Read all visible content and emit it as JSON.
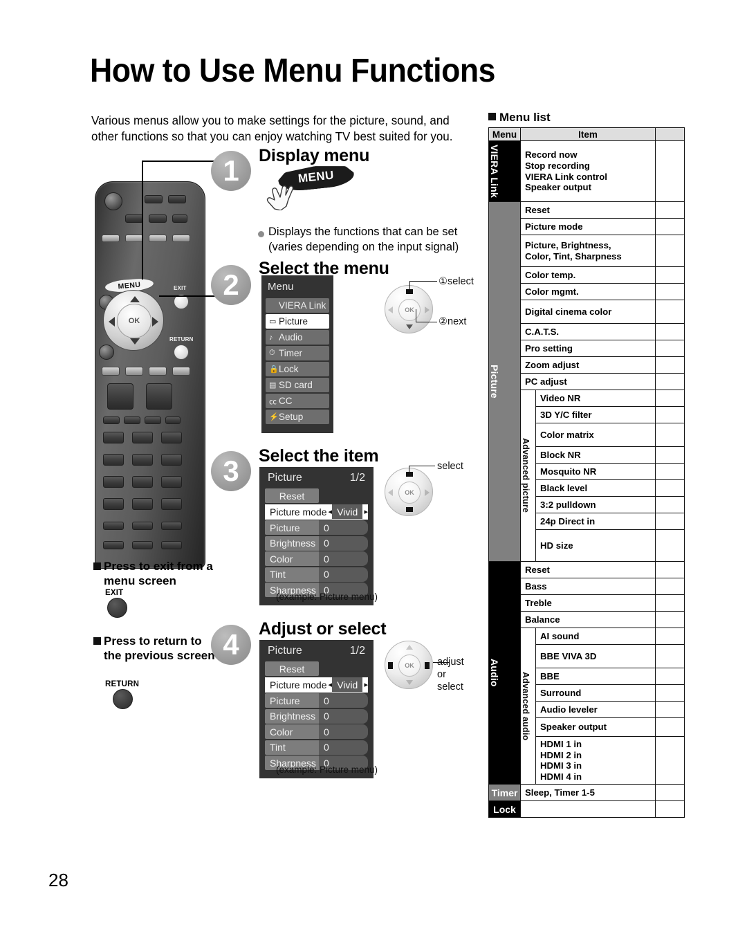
{
  "page": {
    "title": "How to Use Menu Functions",
    "number": "28",
    "intro": "Various menus allow you to make settings for the picture, sound, and other functions so that you can enjoy watching TV best suited for you."
  },
  "steps": [
    {
      "num": "1",
      "title": "Display menu"
    },
    {
      "num": "2",
      "title": "Select the menu"
    },
    {
      "num": "3",
      "title": "Select the item"
    },
    {
      "num": "4",
      "title": "Adjust or select"
    }
  ],
  "step1": {
    "button_label": "MENU",
    "bullet": "Displays the functions that can be set (varies depending on the input signal)"
  },
  "remote": {
    "menu_label": "MENU",
    "exit_label": "EXIT",
    "return_label": "RETURN",
    "ok_label": "OK"
  },
  "step2": {
    "osd_title": "Menu",
    "items": [
      {
        "glyph": "",
        "label": "VIERA Link",
        "active": false
      },
      {
        "glyph": "▭",
        "label": "Picture",
        "active": true
      },
      {
        "glyph": "♪",
        "label": "Audio",
        "active": false
      },
      {
        "glyph": "⏱",
        "label": "Timer",
        "active": false
      },
      {
        "glyph": "🔒",
        "label": "Lock",
        "active": false
      },
      {
        "glyph": "▤",
        "label": "SD card",
        "active": false
      },
      {
        "glyph": "㏄",
        "label": "CC",
        "active": false
      },
      {
        "glyph": "⚡",
        "label": "Setup",
        "active": false
      }
    ],
    "pad_label_1": "①select",
    "pad_label_2": "②next",
    "ok_label": "OK"
  },
  "picture_osd": {
    "title": "Picture",
    "page": "1/2",
    "reset_label": "Reset",
    "selected": {
      "name": "Picture mode",
      "value": "Vivid",
      "left_caret": "◂",
      "right_caret": "▸"
    },
    "rows": [
      {
        "name": "Picture",
        "value": "0"
      },
      {
        "name": "Brightness",
        "value": "0"
      },
      {
        "name": "Color",
        "value": "0"
      },
      {
        "name": "Tint",
        "value": "0"
      },
      {
        "name": "Sharpness",
        "value": "0"
      }
    ],
    "caption": "(example:  Picture menu)"
  },
  "step3": {
    "pad_label": "select",
    "ok_label": "OK"
  },
  "step4": {
    "pad_label": "adjust\nor\nselect",
    "ok_label": "OK"
  },
  "notes": [
    {
      "heading": "Press to exit from a menu screen",
      "button": "EXIT"
    },
    {
      "heading": "Press to return to the previous screen",
      "button": "RETURN"
    }
  ],
  "menu_list": {
    "heading": "Menu list",
    "columns": {
      "menu": "Menu",
      "item": "Item",
      "page": ""
    },
    "groups": [
      {
        "menu": "VIERA Link",
        "menu_style": "black",
        "rows": [
          {
            "item": "Record now\nStop recording\nVIERA Link control\nSpeaker output",
            "tall": 88
          }
        ]
      },
      {
        "menu": "Picture",
        "menu_style": "gray",
        "rows": [
          {
            "item": "Reset",
            "tall": 24
          },
          {
            "item": "Picture mode",
            "tall": 24
          },
          {
            "item": "Picture, Brightness,\nColor, Tint, Sharpness",
            "tall": 44
          },
          {
            "item": "Color temp.",
            "tall": 24
          },
          {
            "item": "Color mgmt.",
            "tall": 24
          },
          {
            "item": "Digital cinema color",
            "tall": 34
          },
          {
            "item": "C.A.T.S.",
            "tall": 24
          },
          {
            "item": "Pro setting",
            "tall": 24
          },
          {
            "item": "Zoom adjust",
            "tall": 24
          },
          {
            "item": "PC adjust",
            "tall": 24
          }
        ],
        "sub": {
          "label": "Advanced picture",
          "rows": [
            {
              "item": "Video NR",
              "tall": 24
            },
            {
              "item": "3D Y/C filter",
              "tall": 24
            },
            {
              "item": "Color matrix",
              "tall": 34
            },
            {
              "item": "Block NR",
              "tall": 24
            },
            {
              "item": "Mosquito NR",
              "tall": 24
            },
            {
              "item": "Black level",
              "tall": 24
            },
            {
              "item": "3:2 pulldown",
              "tall": 24
            },
            {
              "item": "24p Direct in",
              "tall": 24
            },
            {
              "item": "HD size",
              "tall": 44
            }
          ]
        }
      },
      {
        "menu": "Audio",
        "menu_style": "black",
        "rows": [
          {
            "item": "Reset",
            "tall": 24
          },
          {
            "item": "Bass",
            "tall": 24
          },
          {
            "item": "Treble",
            "tall": 24
          },
          {
            "item": "Balance",
            "tall": 24
          }
        ],
        "sub": {
          "label": "Advanced audio",
          "rows": [
            {
              "item": "AI sound",
              "tall": 24
            },
            {
              "item": "BBE VIVA 3D",
              "tall": 34
            },
            {
              "item": "BBE",
              "tall": 24
            },
            {
              "item": "Surround",
              "tall": 24
            },
            {
              "item": "Audio leveler",
              "tall": 24
            },
            {
              "item": "Speaker output",
              "tall": 27
            },
            {
              "item": "HDMI 1 in\nHDMI 2 in\nHDMI 3 in\nHDMI 4 in",
              "tall": 50
            }
          ]
        }
      },
      {
        "menu": "Timer",
        "menu_style": "gray-h",
        "rows": [
          {
            "item": "Sleep, Timer 1-5",
            "tall": 24
          }
        ]
      },
      {
        "menu": "Lock",
        "menu_style": "black-h",
        "rows": [
          {
            "item": "",
            "tall": 24
          }
        ]
      }
    ]
  }
}
